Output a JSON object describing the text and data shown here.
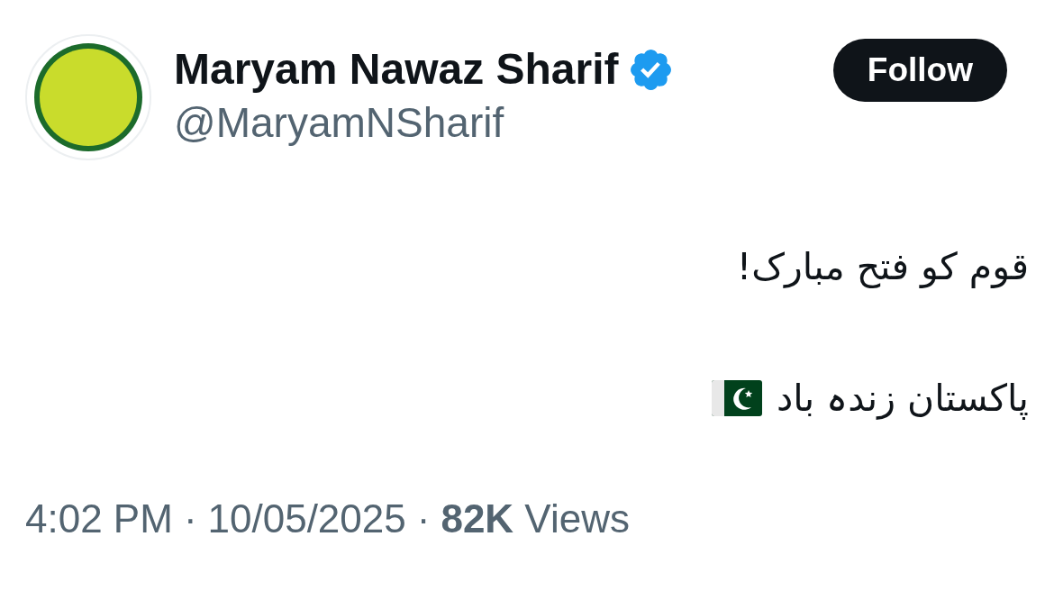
{
  "author": {
    "name": "Maryam Nawaz Sharif",
    "verified": true,
    "handle": "@MaryamNSharif"
  },
  "follow_button": {
    "label": "Follow"
  },
  "post": {
    "lines": [
      {
        "text": "قوم کو فتح مبارک!",
        "flag": false
      },
      {
        "text": "پاکستان زندہ باد",
        "flag": true
      }
    ]
  },
  "meta": [
    {
      "kind": "time",
      "text": "4:02 PM"
    },
    {
      "kind": "separator",
      "text": "·"
    },
    {
      "kind": "date",
      "text": "10/05/2025"
    },
    {
      "kind": "separator",
      "text": "·"
    },
    {
      "kind": "views",
      "text": "**82K** Views"
    }
  ]
}
